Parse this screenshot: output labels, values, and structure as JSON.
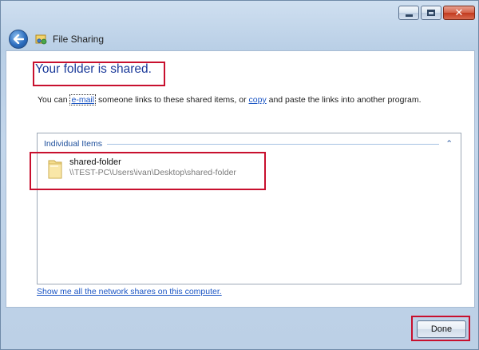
{
  "window": {
    "title": "File Sharing",
    "caption_buttons": {
      "minimize_icon": "minimize-icon",
      "maximize_icon": "maximize-icon",
      "close_glyph": "✕"
    }
  },
  "header": {
    "back_icon": "back-arrow-icon",
    "app_icon": "file-sharing-icon",
    "title": "File Sharing"
  },
  "main": {
    "headline": "Your folder is shared.",
    "description": {
      "prefix": "You can ",
      "email_link": "e-mail",
      "middle": " someone links to these shared items, or ",
      "copy_link": "copy",
      "suffix": " and paste the links into another program."
    },
    "items_group": {
      "header": "Individual Items",
      "collapse_glyph": "⌃",
      "items": [
        {
          "name": "shared-folder",
          "path": "\\\\TEST-PC\\Users\\ivan\\Desktop\\shared-folder",
          "icon": "folder-icon"
        }
      ]
    },
    "network_shares_link": "Show me all the network shares on this computer."
  },
  "footer": {
    "done_label": "Done"
  },
  "colors": {
    "highlight_box": "#c8102e",
    "headline": "#1b3a9a",
    "link": "#1b55c4"
  }
}
